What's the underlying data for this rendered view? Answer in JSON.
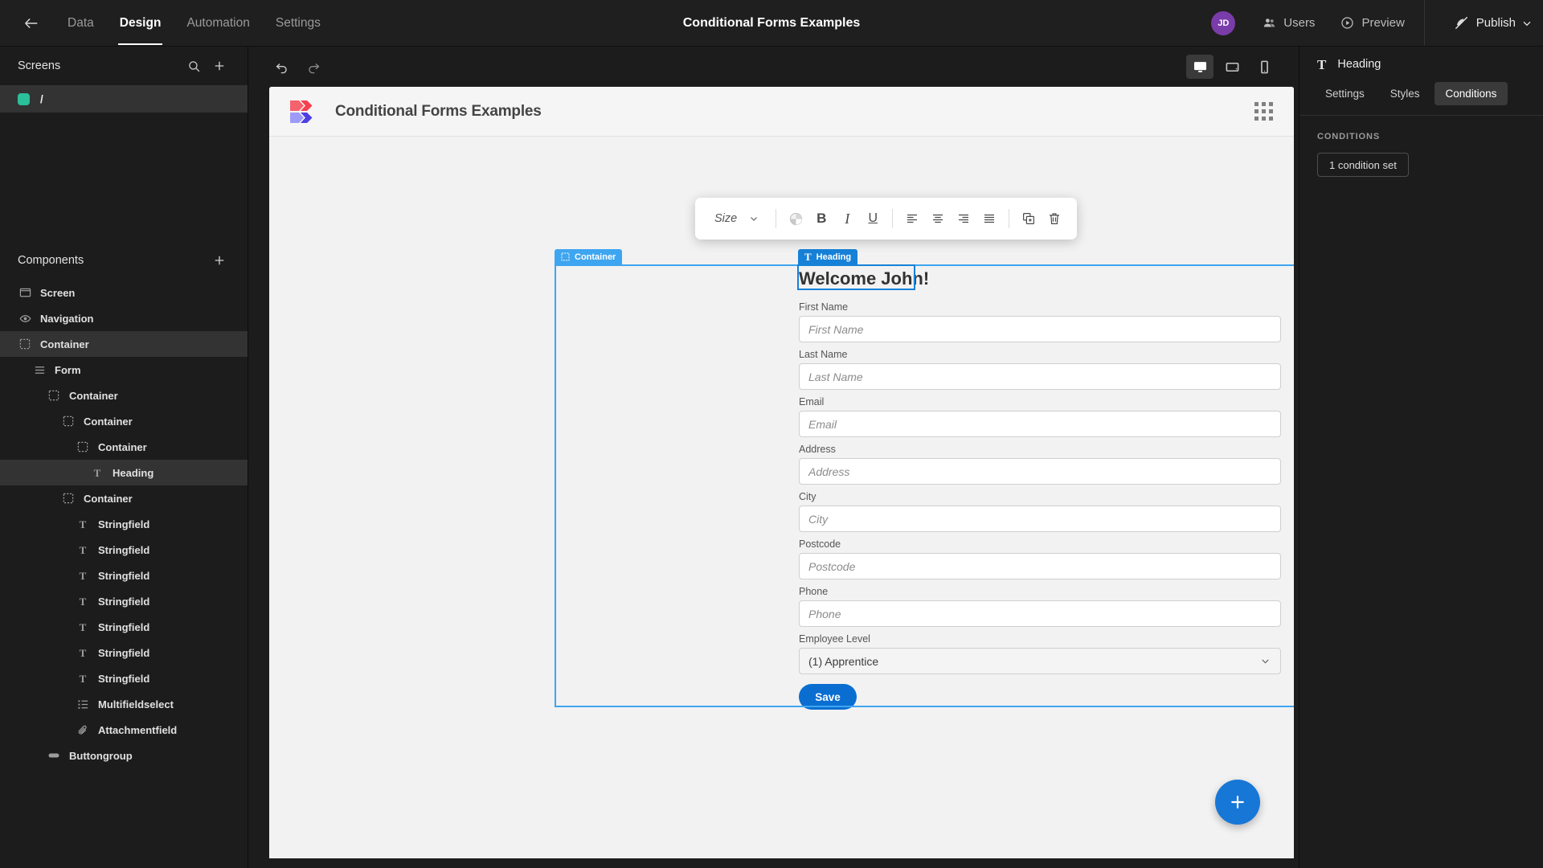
{
  "topbar": {
    "back_icon": "arrow-left-icon",
    "nav": [
      {
        "label": "Data",
        "active": false
      },
      {
        "label": "Design",
        "active": true
      },
      {
        "label": "Automation",
        "active": false
      },
      {
        "label": "Settings",
        "active": false
      }
    ],
    "title": "Conditional Forms Examples",
    "avatar_initials": "JD",
    "avatar_color": "#7a3ca8",
    "users_label": "Users",
    "preview_label": "Preview",
    "publish_label": "Publish"
  },
  "sidebar": {
    "screens_header": "Screens",
    "screens": [
      {
        "label": "/",
        "color": "#2bbf9a",
        "selected": true
      }
    ],
    "components_header": "Components",
    "tree": [
      {
        "label": "Screen",
        "icon": "screen-icon",
        "depth": 0,
        "selected": false
      },
      {
        "label": "Navigation",
        "icon": "eye-icon",
        "depth": 0,
        "selected": false
      },
      {
        "label": "Container",
        "icon": "container-icon",
        "depth": 0,
        "selected": false,
        "highlight": true
      },
      {
        "label": "Form",
        "icon": "form-icon",
        "depth": 1,
        "selected": false
      },
      {
        "label": "Container",
        "icon": "container-icon",
        "depth": 2,
        "selected": false
      },
      {
        "label": "Container",
        "icon": "container-icon",
        "depth": 3,
        "selected": false
      },
      {
        "label": "Container",
        "icon": "container-icon",
        "depth": 4,
        "selected": false
      },
      {
        "label": "Heading",
        "icon": "text-icon",
        "depth": 5,
        "selected": true
      },
      {
        "label": "Container",
        "icon": "container-icon",
        "depth": 3,
        "selected": false
      },
      {
        "label": "Stringfield",
        "icon": "text-icon",
        "depth": 4,
        "selected": false
      },
      {
        "label": "Stringfield",
        "icon": "text-icon",
        "depth": 4,
        "selected": false
      },
      {
        "label": "Stringfield",
        "icon": "text-icon",
        "depth": 4,
        "selected": false
      },
      {
        "label": "Stringfield",
        "icon": "text-icon",
        "depth": 4,
        "selected": false
      },
      {
        "label": "Stringfield",
        "icon": "text-icon",
        "depth": 4,
        "selected": false
      },
      {
        "label": "Stringfield",
        "icon": "text-icon",
        "depth": 4,
        "selected": false
      },
      {
        "label": "Stringfield",
        "icon": "text-icon",
        "depth": 4,
        "selected": false
      },
      {
        "label": "Multifieldselect",
        "icon": "list-icon",
        "depth": 4,
        "selected": false
      },
      {
        "label": "Attachmentfield",
        "icon": "paperclip-icon",
        "depth": 4,
        "selected": false
      },
      {
        "label": "Buttongroup",
        "icon": "buttongroup-icon",
        "depth": 2,
        "selected": false
      }
    ]
  },
  "canvas_toolbar": {
    "undo_icon": "undo-icon",
    "redo_icon": "redo-icon",
    "devices": [
      {
        "name": "desktop",
        "active": true
      },
      {
        "name": "tablet",
        "active": false
      },
      {
        "name": "mobile",
        "active": false
      }
    ]
  },
  "app": {
    "title": "Conditional Forms Examples",
    "logo_colors": {
      "top": "#f4626e",
      "top_dark": "#f5404f",
      "bottom": "#9d9bf7",
      "bottom_dark": "#4b3fe4"
    },
    "grid_icon": "apps-grid-icon"
  },
  "text_toolbar": {
    "size_label": "Size",
    "size_chevron": "chevron-down-icon",
    "color_icon": "color-wheel-icon",
    "bold_label": "B",
    "italic_label": "I",
    "underline_label": "U",
    "align_left_icon": "align-left-icon",
    "align_center_icon": "align-center-icon",
    "align_right_icon": "align-right-icon",
    "align_justify_icon": "align-justify-icon",
    "duplicate_icon": "duplicate-icon",
    "delete_icon": "trash-icon"
  },
  "selection": {
    "container_badge": "Container",
    "heading_badge": "Heading",
    "container_color": "#3ea5f0",
    "heading_color": "#1781d8"
  },
  "form": {
    "heading": "Welcome John!",
    "fields": [
      {
        "label": "First Name",
        "placeholder": "First Name",
        "type": "text"
      },
      {
        "label": "Last Name",
        "placeholder": "Last Name",
        "type": "text"
      },
      {
        "label": "Email",
        "placeholder": "Email",
        "type": "text"
      },
      {
        "label": "Address",
        "placeholder": "Address",
        "type": "text"
      },
      {
        "label": "City",
        "placeholder": "City",
        "type": "text"
      },
      {
        "label": "Postcode",
        "placeholder": "Postcode",
        "type": "text"
      },
      {
        "label": "Phone",
        "placeholder": "Phone",
        "type": "text"
      },
      {
        "label": "Employee Level",
        "value": "(1) Apprentice",
        "type": "select"
      }
    ],
    "save_label": "Save",
    "save_color": "#0a6ed1"
  },
  "fab": {
    "icon": "plus-icon",
    "color": "#1777d6"
  },
  "rightpanel": {
    "icon": "text-icon",
    "title": "Heading",
    "tabs": [
      {
        "label": "Settings",
        "active": false
      },
      {
        "label": "Styles",
        "active": false
      },
      {
        "label": "Conditions",
        "active": true
      }
    ],
    "section_label": "CONDITIONS",
    "condition_chip": "1 condition set"
  }
}
